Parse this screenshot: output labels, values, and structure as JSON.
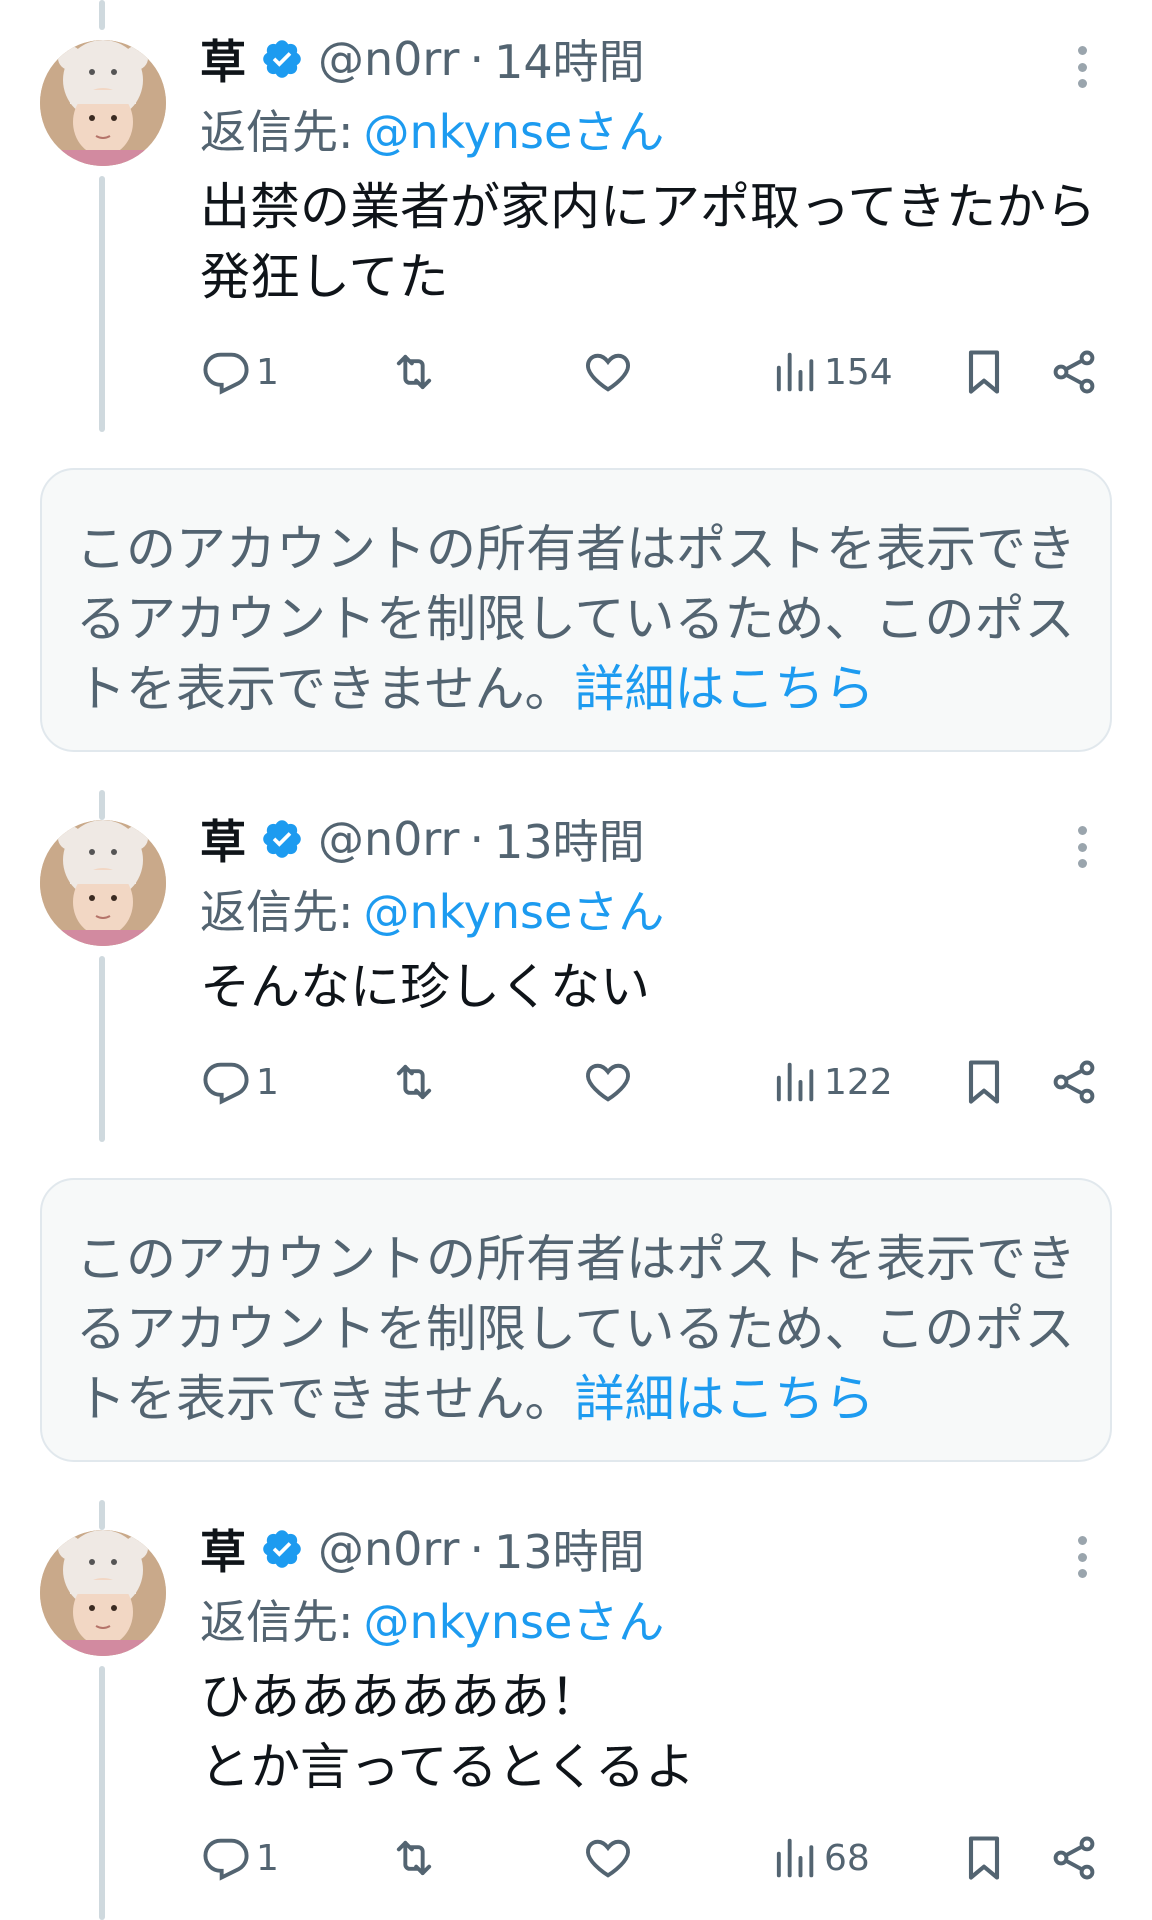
{
  "tweets": [
    {
      "display_name": "草",
      "handle": "@n0rr",
      "separator": "·",
      "time": "14時間",
      "reply_label": "返信先:",
      "reply_to": "@nkynseさん",
      "text": "出禁の業者が家内にアポ取ってきたから\n発狂してた",
      "reply_count": "1",
      "views": "154"
    },
    {
      "display_name": "草",
      "handle": "@n0rr",
      "separator": "·",
      "time": "13時間",
      "reply_label": "返信先:",
      "reply_to": "@nkynseさん",
      "text": "そんなに珍しくない",
      "reply_count": "1",
      "views": "122"
    },
    {
      "display_name": "草",
      "handle": "@n0rr",
      "separator": "·",
      "time": "13時間",
      "reply_label": "返信先:",
      "reply_to": "@nkynseさん",
      "text": "ひああああああ！\nとか言ってるとくるよ",
      "reply_count": "1",
      "views": "68"
    }
  ],
  "notices": [
    {
      "text": "このアカウントの所有者はポストを表示できるアカウントを制限しているため、このポストを表示できません。",
      "link": "詳細はこちら"
    },
    {
      "text": "このアカウントの所有者はポストを表示できるアカウントを制限しているため、このポストを表示できません。",
      "link": "詳細はこちら"
    }
  ],
  "icons": {
    "verified": "verified-badge-icon",
    "reply": "reply-icon",
    "retweet": "retweet-icon",
    "like": "heart-icon",
    "views": "views-icon",
    "bookmark": "bookmark-icon",
    "share": "share-icon",
    "more": "more-dots-icon"
  },
  "colors": {
    "accent": "#1d9bf0",
    "secondary_text": "#536471",
    "notice_bg": "#f7f9f9"
  }
}
